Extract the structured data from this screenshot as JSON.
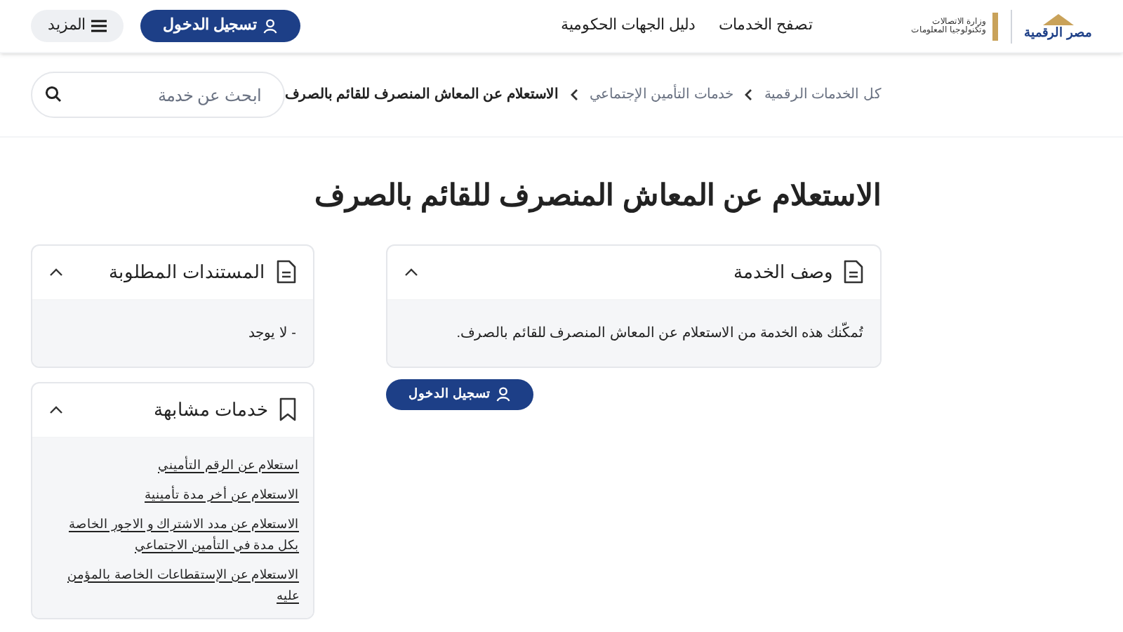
{
  "header": {
    "logo": {
      "name": "مصر الرقمية"
    },
    "ministry_logo": {
      "line_1": "وزارة الاتصالات",
      "line_2": "وتكنولوجيا المعلومات"
    },
    "nav": [
      "تصفح الخدمات",
      "دليل الجهات الحكومية"
    ],
    "login_button": "تسجيل الدخول",
    "more_button": "المزيد"
  },
  "breadcrumb": [
    "كل الخدمات الرقمية",
    "خدمات التأمين الإجتماعي",
    "الاستعلام عن المعاش المنصرف للقائم بالصرف"
  ],
  "search": {
    "placeholder": "ابحث عن خدمة"
  },
  "page_title": "الاستعلام عن المعاش المنصرف للقائم بالصرف",
  "main_panels": [
    {
      "kind": "document",
      "title": "وصف الخدمة",
      "expanded": true,
      "text": "تُمكّنك هذه الخدمة من الاستعلام عن المعاش المنصرف للقائم بالصرف."
    }
  ],
  "login_button": "تسجيل الدخول",
  "side_panels": [
    {
      "kind": "document",
      "title": "المستندات المطلوبة",
      "expanded": true,
      "text": "- لا يوجد"
    },
    {
      "kind": "bookmark",
      "title": "خدمات مشابهة",
      "expanded": true,
      "links": [
        "استعلام عن الرقم التأميني",
        "الاستعلام عن أخر مدة تأمينية",
        "الاستعلام عن مدد الاشتراك و الاجور الخاصة بكل مدة في التأمين الاجتماعي",
        "الاستعلام عن الإستقطاعات الخاصة بالمؤمن عليه"
      ]
    }
  ]
}
